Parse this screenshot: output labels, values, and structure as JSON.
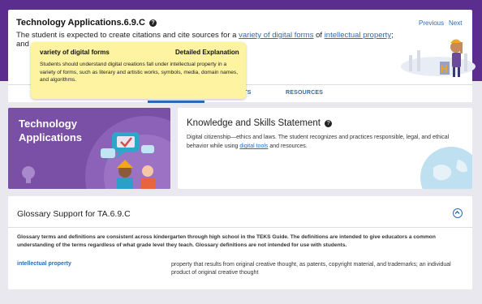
{
  "standard": {
    "title": "Technology Applications.6.9.C",
    "help_glyph": "?",
    "nav_previous": "Previous",
    "nav_next": "Next",
    "text_before": "The student is expected to create citations and cite sources for a ",
    "link_digital_forms": "variety of digital forms",
    "text_middle": " of ",
    "link_ip": "intellectual property",
    "text_after": "; and"
  },
  "tooltip": {
    "term": "variety of digital forms",
    "heading": "Detailed Explanation",
    "body": "Students should understand digital creations fall under intellectual property in a variety of forms, such as literary and artistic works, symbols, media, domain names, and algorithms."
  },
  "tabs": {
    "items": [
      {
        "label": "NTS"
      },
      {
        "label": "RESOURCES"
      }
    ]
  },
  "ta_card": {
    "line1": "Technology",
    "line2": "Applications"
  },
  "ks_card": {
    "title": "Knowledge and Skills Statement",
    "help_glyph": "?",
    "text_before": "Digital citizenship—ethics and laws. The student recognizes and practices responsible, legal, and ethical behavior while using ",
    "link": "digital tools",
    "text_after": " and resources."
  },
  "glossary": {
    "title": "Glossary Support for TA.6.9.C",
    "intro": "Glossary terms and definitions are consistent across kindergarten through high school in the TEKS Guide. The definitions are intended to give educators a common understanding of the terms regardless of what grade level they teach. Glossary definitions are not intended for use with students.",
    "entries": [
      {
        "term": "intellectual property",
        "definition": "property that results from original creative thought, as patents, copyright material, and trademarks; an individual product of original creative thought"
      }
    ]
  },
  "colors": {
    "brand_purple": "#5b2d8e",
    "link_blue": "#2a6cb5",
    "tooltip_yellow": "#fdf3a0"
  }
}
